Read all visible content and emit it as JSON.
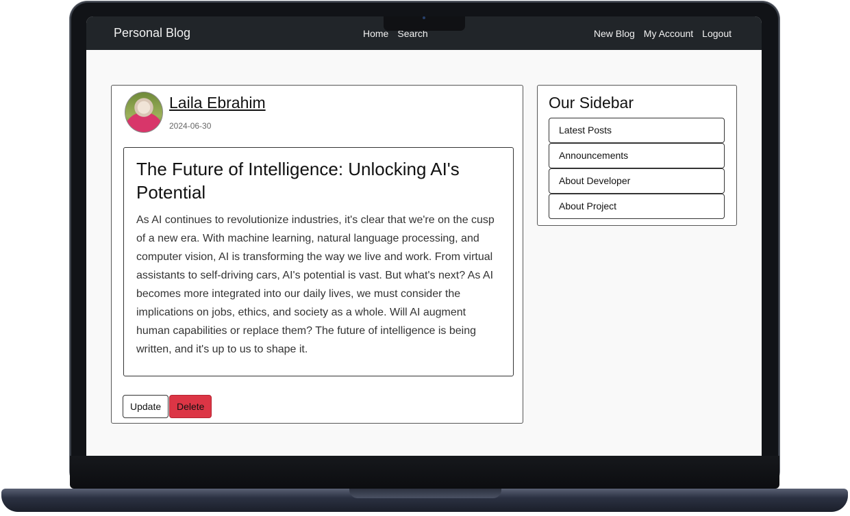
{
  "navbar": {
    "brand": "Personal Blog",
    "center_links": [
      "Home",
      "Search"
    ],
    "right_links": [
      "New Blog",
      "My Account",
      "Logout"
    ]
  },
  "post": {
    "author": "Laila Ebrahim",
    "date": "2024-06-30",
    "title": "The Future of Intelligence: Unlocking AI's Potential",
    "body": "As AI continues to revolutionize industries, it's clear that we're on the cusp of a new era. With machine learning, natural language processing, and computer vision, AI is transforming the way we live and work. From virtual assistants to self-driving cars, AI's potential is vast. But what's next? As AI becomes more integrated into our daily lives, we must consider the implications on jobs, ethics, and society as a whole. Will AI augment human capabilities or replace them? The future of intelligence is being written, and it's up to us to shape it.",
    "update_label": "Update",
    "delete_label": "Delete"
  },
  "sidebar": {
    "title": "Our Sidebar",
    "items": [
      {
        "label": "Latest Posts"
      },
      {
        "label": "Announcements"
      },
      {
        "label": "About Developer"
      },
      {
        "label": "About Project"
      }
    ]
  },
  "colors": {
    "navbar_bg": "#212529",
    "delete_button": "#dc3545",
    "page_bg": "#f9f9f9"
  }
}
